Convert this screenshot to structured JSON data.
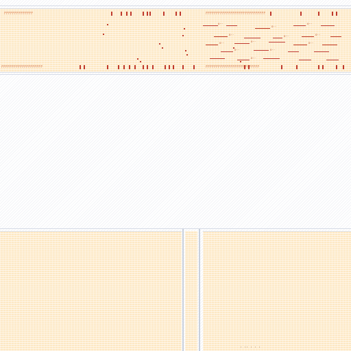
{
  "window": {
    "title": ""
  },
  "top_panel": {
    "ruler_left_text": "FFFFFFFFFFFFFF",
    "ruler_right_text": "FFFFFFFFFFFFFFFFFFFFFFFFFFFFF",
    "bottom_ruler_left_text": "FFFFFFFFFFFFFFFFFFFF",
    "bottom_ruler_right_text": "FFFFFFFFFFFFFFFFFFFFFFFFFF",
    "dim_labels": [
      "o--",
      "o--",
      "o--",
      "o--",
      "o--",
      "o--",
      "o--",
      "o--",
      "o--",
      "o--",
      "o--",
      "o--"
    ]
  },
  "bottom_panel": {
    "footer_glyphs": "·  ··  ·  ·  ·"
  },
  "colors": {
    "panel_bg": "#fde8c4",
    "accent": "#c0392b",
    "text": "#d46a3a",
    "divider": "#d6dbe6"
  }
}
